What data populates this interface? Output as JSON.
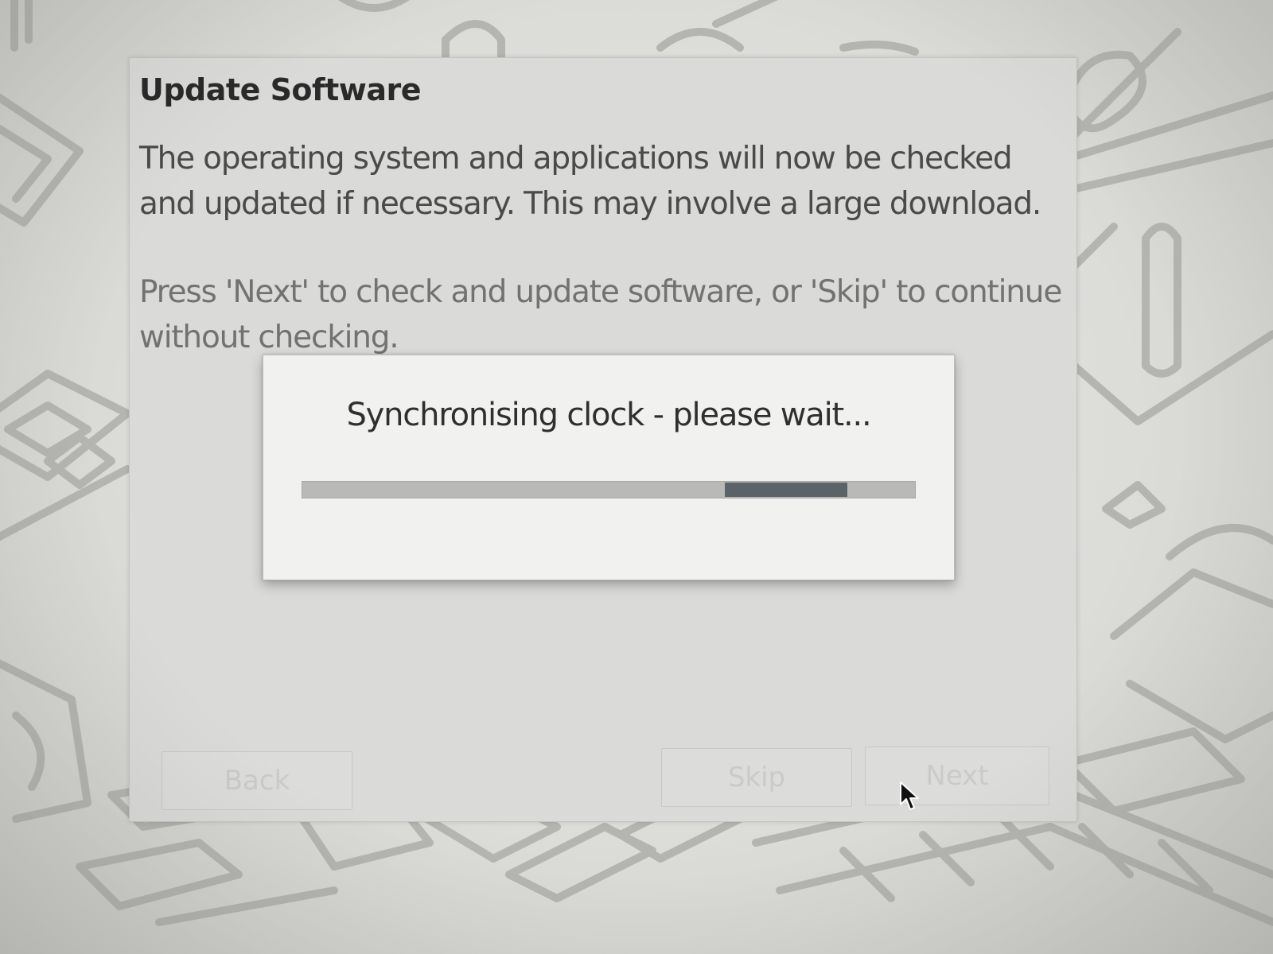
{
  "dialog": {
    "title": "Update Software",
    "paragraph_1": "The operating system and applications will now be checked and updated if necessary. This may involve a large download.",
    "paragraph_2": "Press 'Next' to check and update software, or 'Skip' to continue without checking."
  },
  "buttons": {
    "back_label": "Back",
    "skip_label": "Skip",
    "next_label": "Next"
  },
  "progress_dialog": {
    "message": "Synchronising clock - please wait...",
    "mode": "indeterminate",
    "pulse_start_fraction": 0.69,
    "pulse_end_fraction": 0.89
  },
  "icons": {
    "cursor": "arrow-cursor-icon"
  },
  "colors": {
    "dialog_background": "#dadad8",
    "progress_pulse": "#5b6268",
    "wallpaper_lines": "#b4b4b1"
  }
}
